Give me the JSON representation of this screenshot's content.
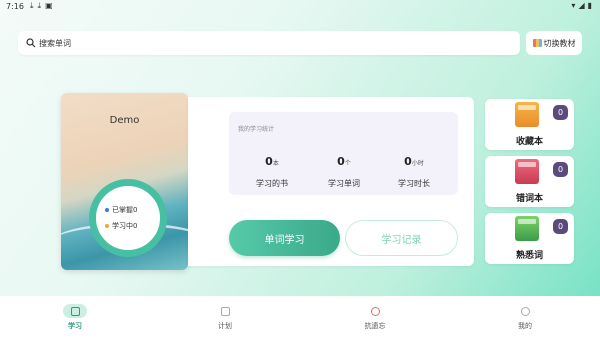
{
  "status_bar": {
    "time": "7:16"
  },
  "search": {
    "placeholder": "搜索单词"
  },
  "switch_button": {
    "label": "切换教材"
  },
  "book": {
    "title": "Demo",
    "legend": [
      {
        "label": "已掌握0",
        "color": "#3b7bd8"
      },
      {
        "label": "学习中0",
        "color": "#f0a53a"
      }
    ]
  },
  "stats": {
    "title": "我的学习统计",
    "items": [
      {
        "value": "0",
        "unit": "本",
        "label": "学习的书"
      },
      {
        "value": "0",
        "unit": "个",
        "label": "学习单词"
      },
      {
        "value": "0",
        "unit": "小时",
        "label": "学习时长"
      }
    ]
  },
  "actions": {
    "study": "单词学习",
    "record": "学习记录"
  },
  "side_cards": [
    {
      "label": "收藏本",
      "count": "0"
    },
    {
      "label": "错词本",
      "count": "0"
    },
    {
      "label": "熟悉词",
      "count": "0"
    }
  ],
  "nav": [
    {
      "label": "学习",
      "icon": "calendar-icon",
      "active": true
    },
    {
      "label": "计划",
      "icon": "plan-icon",
      "active": false
    },
    {
      "label": "抗遗忘",
      "icon": "memory-icon",
      "active": false
    },
    {
      "label": "我的",
      "icon": "user-icon",
      "active": false
    }
  ],
  "colors": {
    "accent": "#3aa989",
    "badge": "#5b4a7c"
  }
}
